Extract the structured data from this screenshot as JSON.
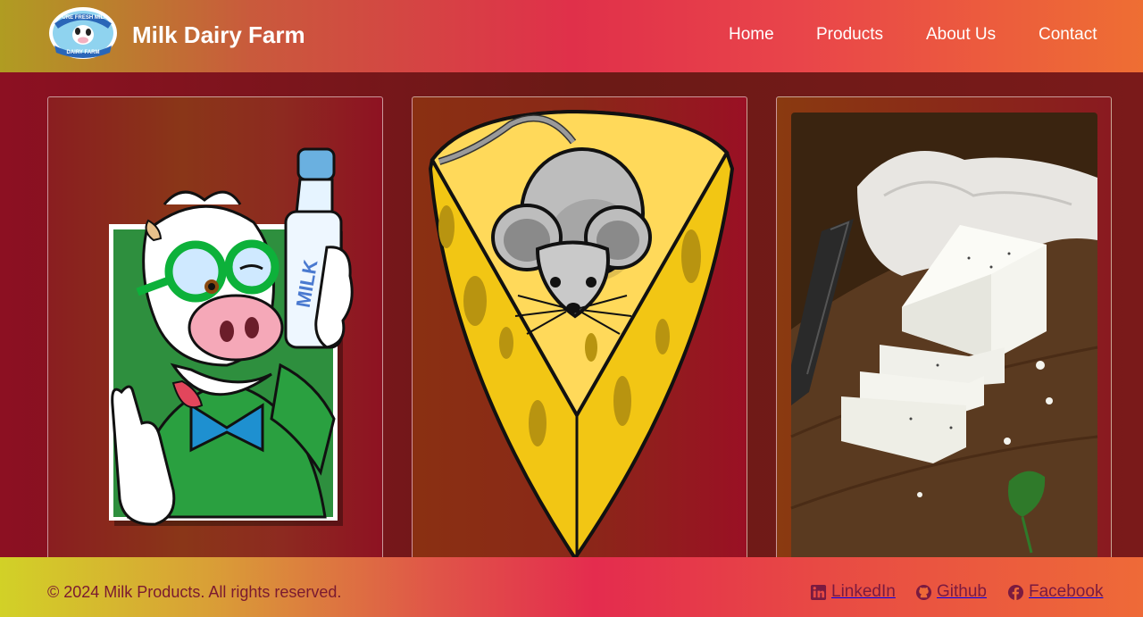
{
  "header": {
    "brand": "Milk Dairy Farm",
    "logo_text_top": "PURE FRESH MILK",
    "logo_text_bottom": "DAIRY FARM",
    "nav": [
      {
        "label": "Home"
      },
      {
        "label": "Products"
      },
      {
        "label": "About Us"
      },
      {
        "label": "Contact"
      }
    ]
  },
  "products": [
    {
      "image": "cow-with-milk-bottle",
      "bottle_label": "MILK"
    },
    {
      "image": "mouse-on-cheese"
    },
    {
      "image": "paneer-on-cutting-board"
    }
  ],
  "footer": {
    "copyright": "© 2024 Milk Products. All rights reserved.",
    "social": [
      {
        "label": "LinkedIn",
        "icon": "linkedin-icon"
      },
      {
        "label": "Github",
        "icon": "github-icon"
      },
      {
        "label": "Facebook",
        "icon": "facebook-icon"
      }
    ]
  },
  "colors": {
    "header_start": "#b09c22",
    "header_mid": "#e0304a",
    "header_end": "#ee6e33",
    "footer_text": "#7a1a30",
    "body_bg": "#7a1a1a"
  }
}
